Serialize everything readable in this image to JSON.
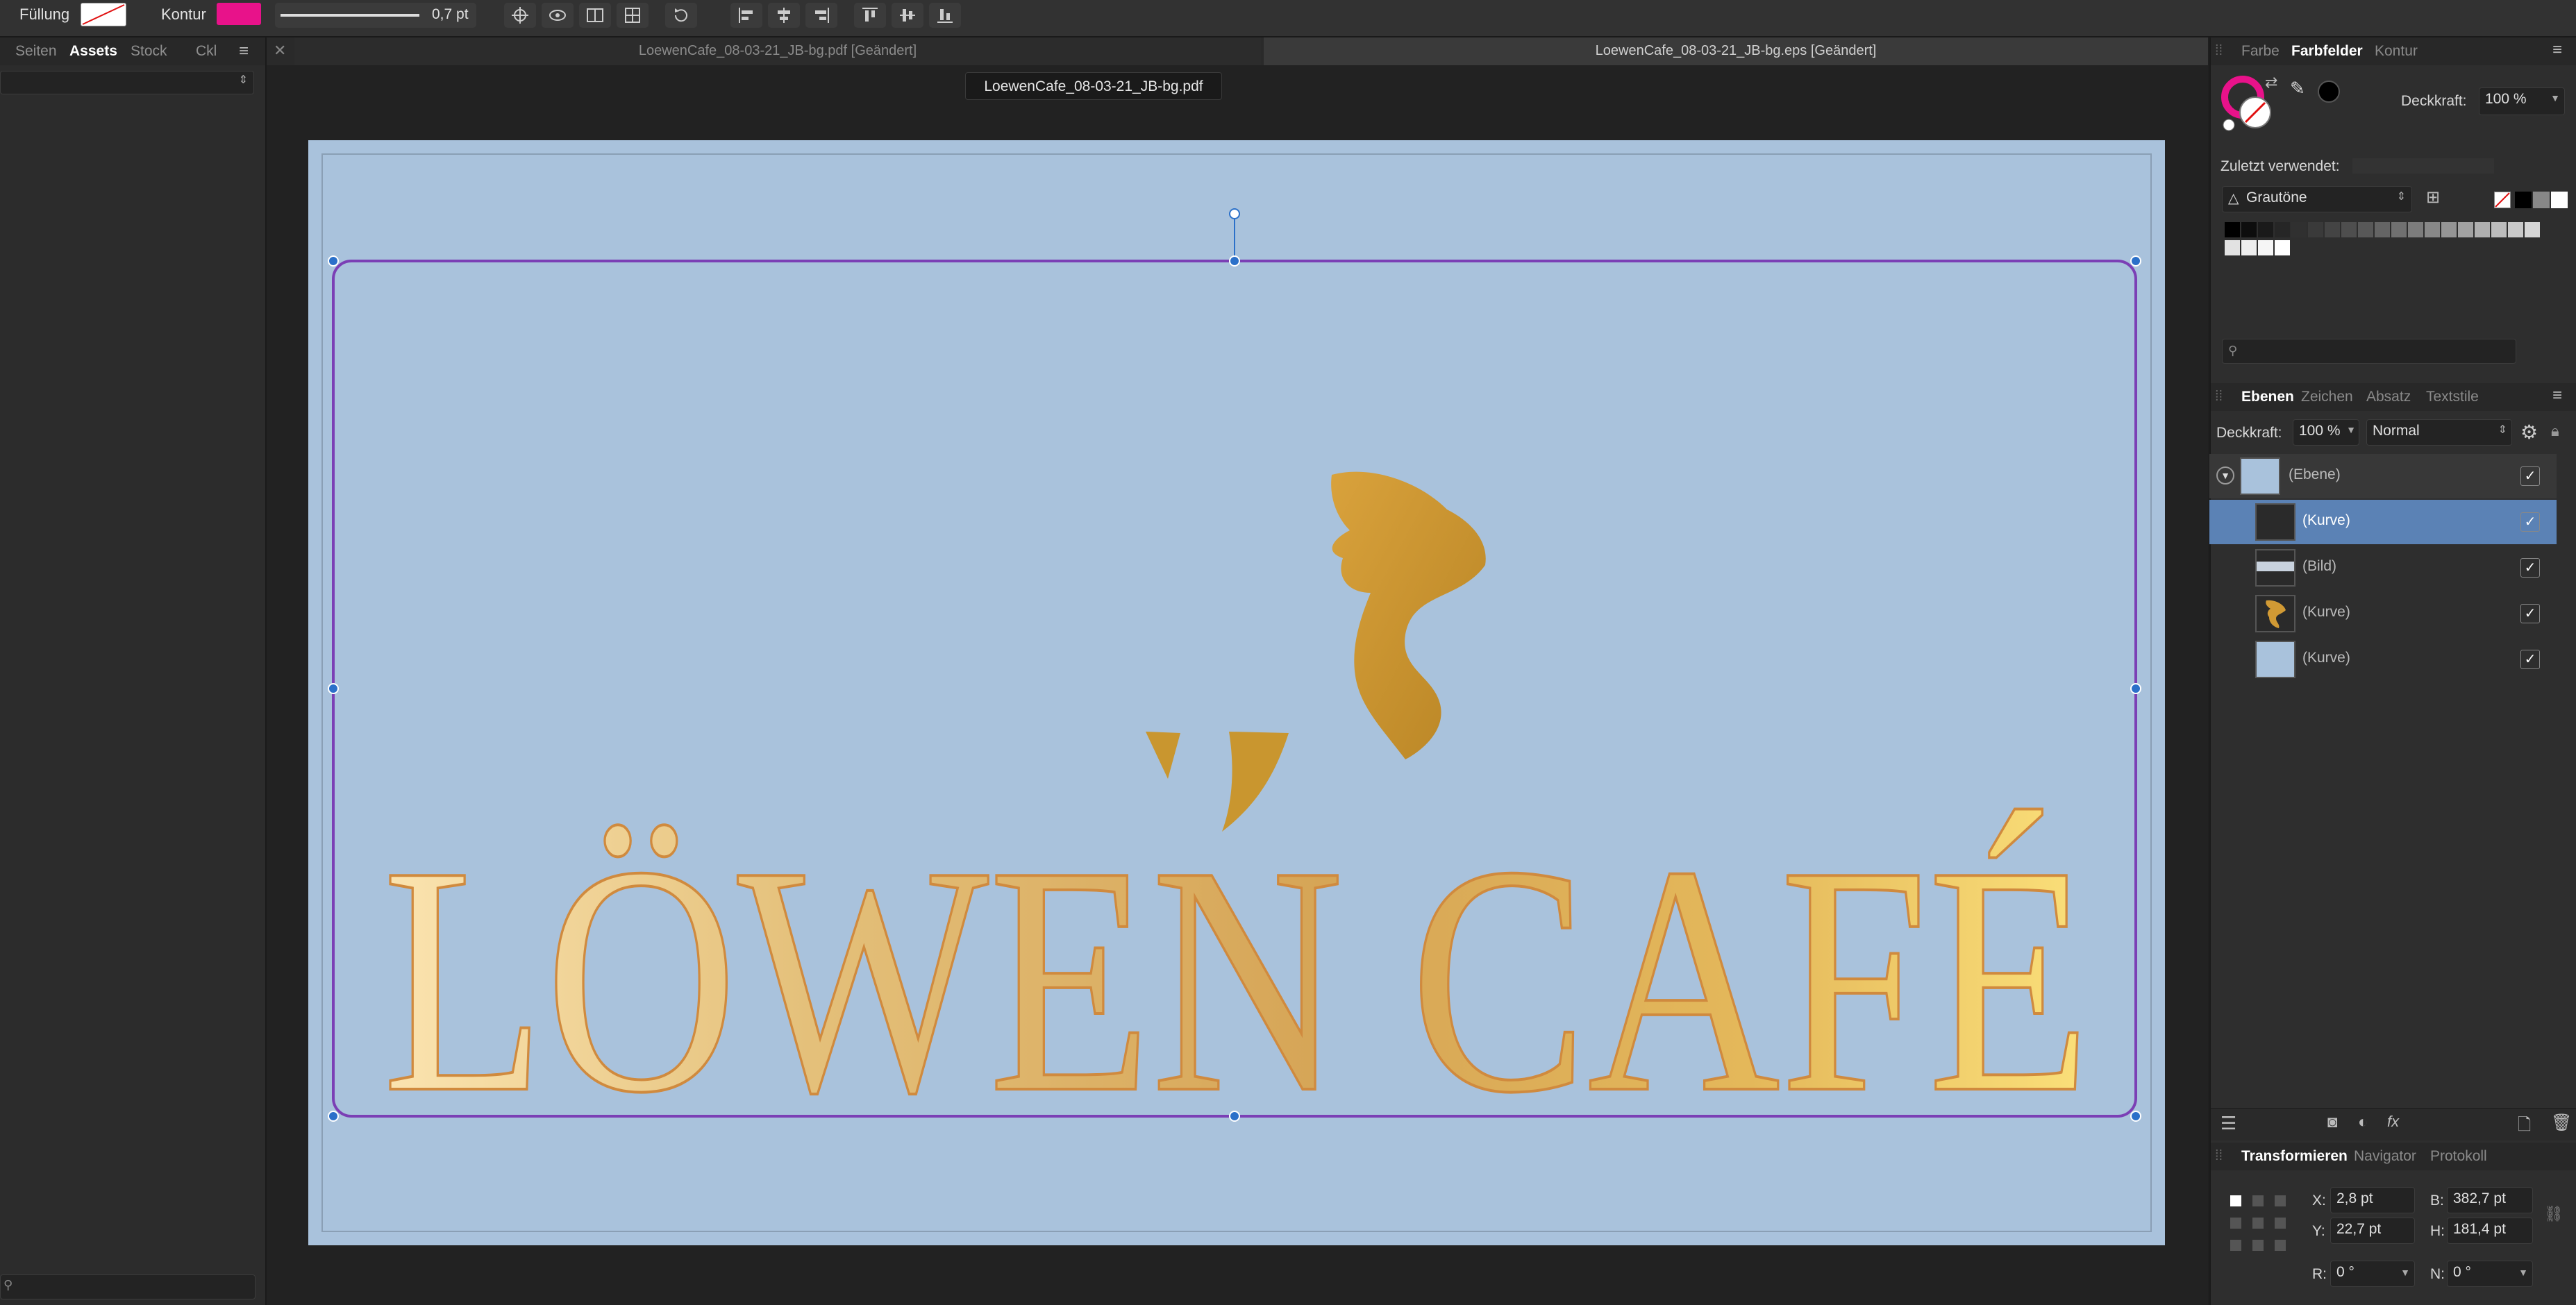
{
  "toolbar": {
    "fill_label": "Füllung",
    "stroke_label": "Kontur",
    "stroke_width": "0,7 pt",
    "stroke_color": "#e8128a"
  },
  "left_panel": {
    "tabs": [
      "Seiten",
      "Assets",
      "Stock",
      "Ckl"
    ],
    "active_tab": "Assets"
  },
  "doc_tabs": {
    "tab1": "LoewenCafe_08-03-21_JB-bg.pdf [Geändert]",
    "tab2": "LoewenCafe_08-03-21_JB-bg.eps [Geändert]",
    "title_tooltip": "LoewenCafe_08-03-21_JB-bg.pdf"
  },
  "artwork": {
    "text": "LÖWEN CAFÉ",
    "background_color": "#a9c2dc",
    "gold_color": "#d4a03a"
  },
  "color_panel": {
    "tabs": [
      "Farbe",
      "Farbfelder",
      "Kontur"
    ],
    "active_tab": "Farbfelder",
    "opacity_label": "Deckkraft:",
    "opacity_value": "100 %",
    "recent_label": "Zuletzt verwendet:",
    "palette_name": "Grautöne"
  },
  "layers_panel": {
    "tabs": [
      "Ebenen",
      "Zeichen",
      "Absatz",
      "Textstile"
    ],
    "active_tab": "Ebenen",
    "opacity_label": "Deckkraft:",
    "opacity_value": "100 %",
    "blend_mode": "Normal",
    "layers": [
      {
        "label": "(Ebene)"
      },
      {
        "label": "(Kurve)"
      },
      {
        "label": "(Bild)"
      },
      {
        "label": "(Kurve)"
      },
      {
        "label": "(Kurve)"
      }
    ]
  },
  "transform_panel": {
    "tabs": [
      "Transformieren",
      "Navigator",
      "Protokoll"
    ],
    "active_tab": "Transformieren",
    "x_label": "X:",
    "x_value": "2,8 pt",
    "y_label": "Y:",
    "y_value": "22,7 pt",
    "w_label": "B:",
    "w_value": "382,7 pt",
    "h_label": "H:",
    "h_value": "181,4 pt",
    "r_label": "R:",
    "r_value": "0 °",
    "s_label": "N:",
    "s_value": "0 °"
  }
}
